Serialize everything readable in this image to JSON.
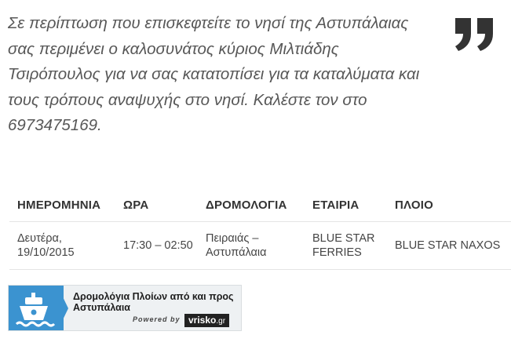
{
  "quote": {
    "text": "Σε περίπτωση που επισκεφτείτε το νησί της Αστυπάλαιας σας περιμένει ο καλοσυνάτος κύριος Μιλτιάδης Τσιρόπουλος για να σας κατατοπίσει για τα καταλύματα και τους τρόπους αναψυχής στο νησί. Καλέστε τον στο 6973475169.",
    "icon": "quote-icon",
    "icon_color": "#333333"
  },
  "schedule": {
    "headers": [
      "ΗΜΕΡΟΜΗΝΙΑ",
      "ΩΡΑ",
      "ΔΡΟΜΟΛΟΓΙΑ",
      "ΕΤΑΙΡΙΑ",
      "ΠΛΟΙΟ"
    ],
    "rows": [
      [
        "Δευτέρα, 19/10/2015",
        "17:30 – 02:50",
        "Πειραιάς – Αστυπάλαια",
        "BLUE STAR FERRIES",
        "BLUE STAR NAXOS"
      ]
    ]
  },
  "banner": {
    "title": "Δρομολόγια Πλοίων από και προς Αστυπάλαια",
    "powered_by": "Powered by",
    "brand": "vrisko",
    "brand_tld": ".gr",
    "icon": "ship-icon",
    "accent_color": "#3b93d0"
  }
}
